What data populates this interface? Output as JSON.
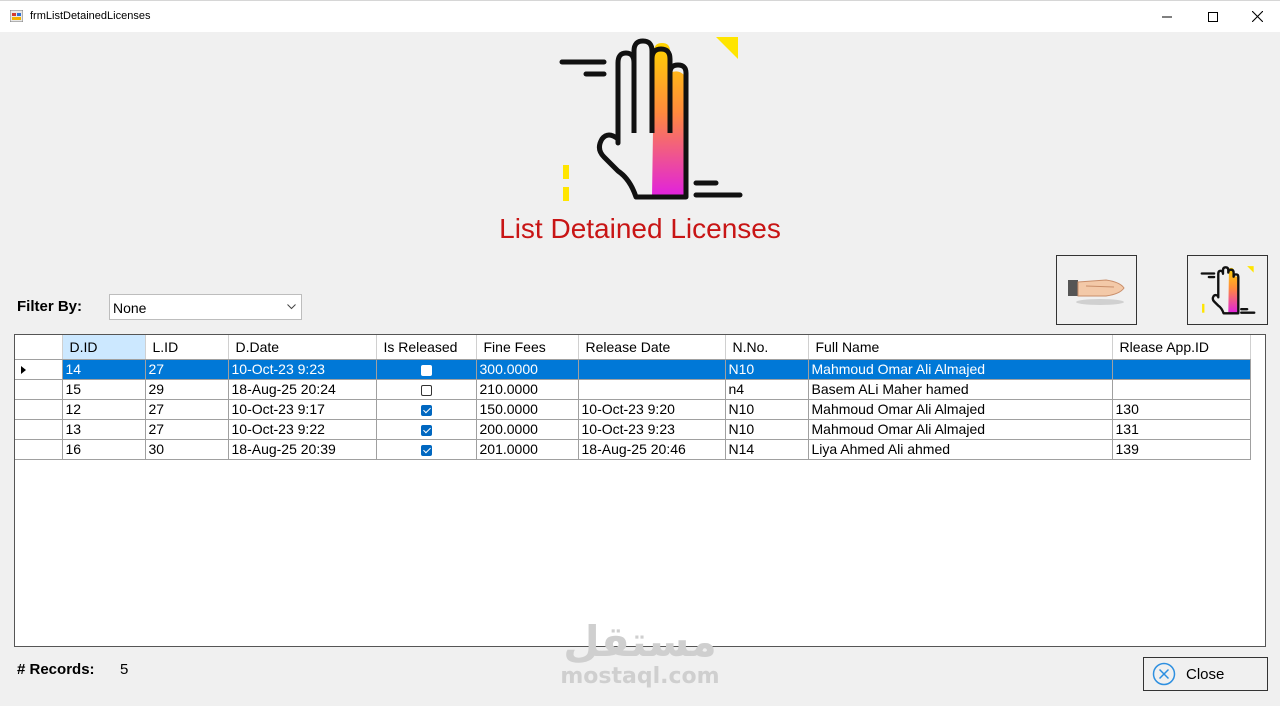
{
  "window": {
    "title": "frmListDetainedLicenses"
  },
  "header": {
    "page_title": "List Detained Licenses"
  },
  "filter": {
    "label": "Filter By:",
    "selected": "None"
  },
  "grid": {
    "columns": [
      "D.ID",
      "L.ID",
      "D.Date",
      "Is Released",
      "Fine Fees",
      "Release Date",
      "N.No.",
      "Full Name",
      "Rlease App.ID"
    ],
    "rows": [
      {
        "did": "14",
        "lid": "27",
        "ddate": "10-Oct-23 9:23",
        "released": false,
        "fees": "300.0000",
        "rdate": "",
        "nno": "N10",
        "name": "Mahmoud Omar Ali Almajed",
        "appid": ""
      },
      {
        "did": "15",
        "lid": "29",
        "ddate": "18-Aug-25 20:24",
        "released": false,
        "fees": "210.0000",
        "rdate": "",
        "nno": "n4",
        "name": "Basem ALi Maher hamed",
        "appid": ""
      },
      {
        "did": "12",
        "lid": "27",
        "ddate": "10-Oct-23 9:17",
        "released": true,
        "fees": "150.0000",
        "rdate": "10-Oct-23 9:20",
        "nno": "N10",
        "name": "Mahmoud Omar Ali Almajed",
        "appid": "130"
      },
      {
        "did": "13",
        "lid": "27",
        "ddate": "10-Oct-23 9:22",
        "released": true,
        "fees": "200.0000",
        "rdate": "10-Oct-23 9:23",
        "nno": "N10",
        "name": "Mahmoud Omar Ali Almajed",
        "appid": "131"
      },
      {
        "did": "16",
        "lid": "30",
        "ddate": "18-Aug-25 20:39",
        "released": true,
        "fees": "201.0000",
        "rdate": "18-Aug-25 20:46",
        "nno": "N14",
        "name": "Liya Ahmed Ali ahmed",
        "appid": "139"
      }
    ]
  },
  "footer": {
    "records_label": "# Records:",
    "records_count": "5",
    "close_label": "Close"
  },
  "watermark": {
    "arabic": "مستقل",
    "latin": "mostaql.com"
  },
  "colors": {
    "title_red": "#c81515",
    "selection_blue": "#0078d7",
    "header_selected": "#cce8ff",
    "checkbox_blue": "#0067c0"
  }
}
